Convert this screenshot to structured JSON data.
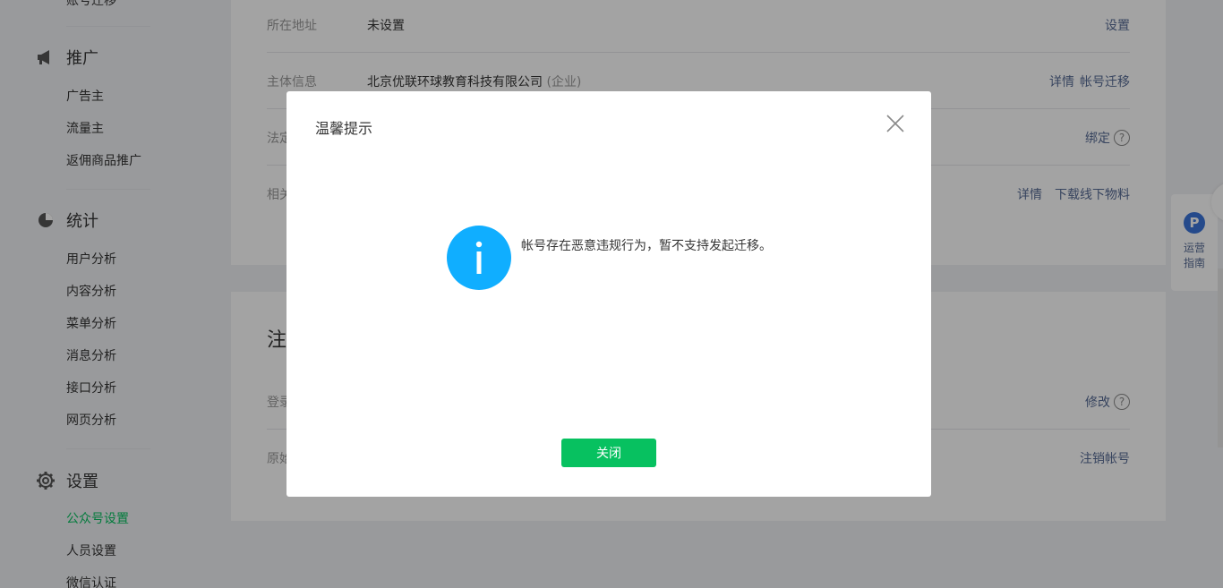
{
  "sidebar": {
    "top_item": "账号迁移",
    "groups": [
      {
        "title": "推广",
        "icon": "megaphone-icon",
        "items": [
          "广告主",
          "流量主",
          "返佣商品推广"
        ]
      },
      {
        "title": "统计",
        "icon": "pie-chart-icon",
        "items": [
          "用户分析",
          "内容分析",
          "菜单分析",
          "消息分析",
          "接口分析",
          "网页分析"
        ]
      },
      {
        "title": "设置",
        "icon": "gear-icon",
        "items": [
          "公众号设置",
          "人员设置",
          "微信认证"
        ]
      }
    ],
    "active_item": "公众号设置"
  },
  "main": {
    "info_rows": [
      {
        "label": "所在地址",
        "value": "未设置",
        "actions": [
          "设置"
        ]
      },
      {
        "label": "主体信息",
        "value": "北京优联环球教育科技有限公司",
        "value_sub": "(企业)",
        "actions": [
          "详情",
          "帐号迁移"
        ]
      },
      {
        "label": "法定",
        "value": "",
        "actions": [
          "绑定"
        ]
      },
      {
        "label": "相关",
        "value": "",
        "actions": [
          "详情",
          "下载线下物料"
        ]
      }
    ],
    "section2": {
      "title": "注",
      "rows": [
        {
          "label": "登录",
          "actions": [
            "修改"
          ]
        },
        {
          "label": "原始",
          "actions": [
            "注销帐号"
          ]
        }
      ]
    }
  },
  "guide": {
    "icon_letter": "P",
    "label": "运营指南"
  },
  "dialog": {
    "title": "温馨提示",
    "icon": "info-icon",
    "message": "帐号存在恶意违规行为，暂不支持发起迁移。",
    "button": "关闭"
  },
  "colors": {
    "accent": "#07c160",
    "info": "#10aeff",
    "link": "#576b95"
  }
}
